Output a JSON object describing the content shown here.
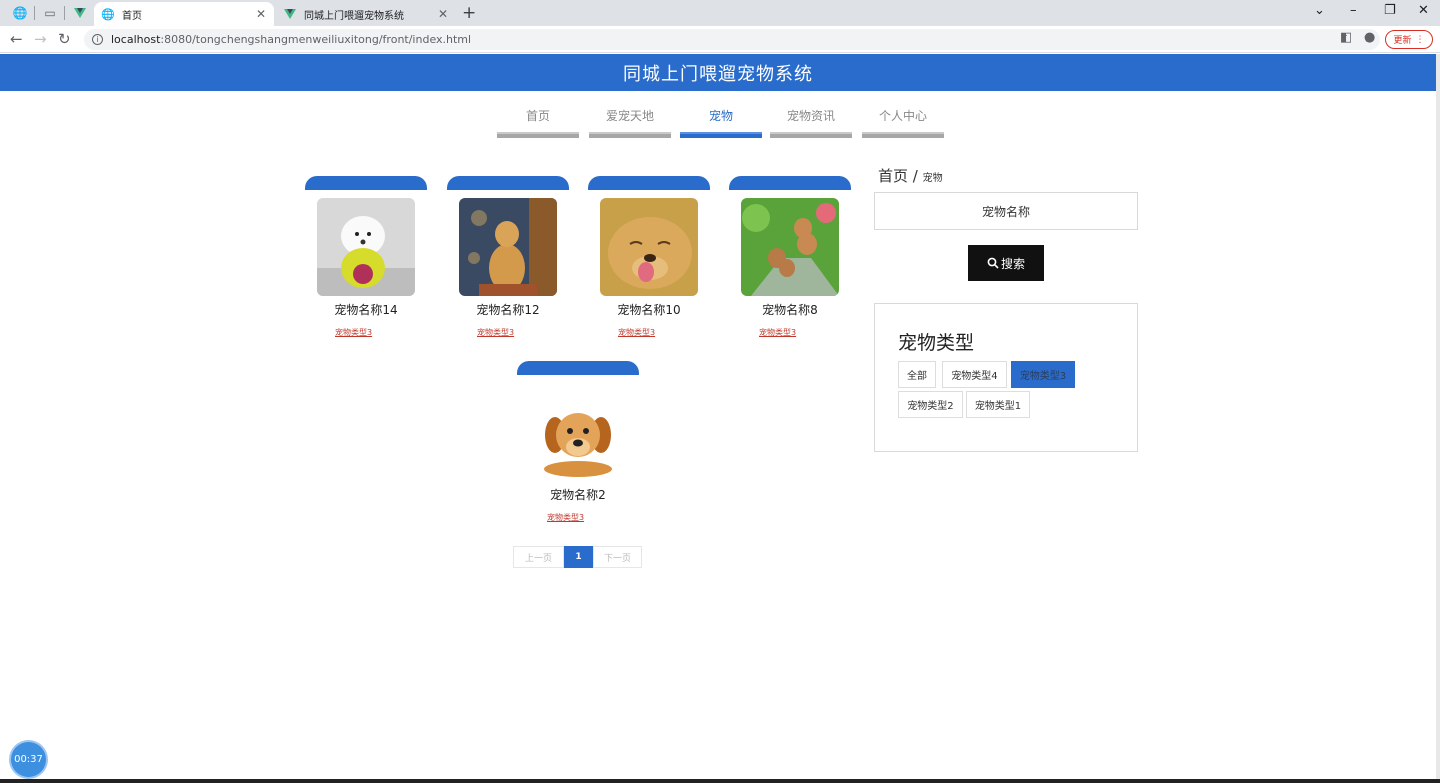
{
  "browser": {
    "tabs": [
      {
        "title": "首页",
        "active": true
      },
      {
        "title": "同城上门喂遛宠物系统",
        "active": false
      }
    ],
    "url_host": "localhost",
    "url_rest": ":8080/tongchengshangmenweiliuxitong/front/index.html",
    "update_label": "更新"
  },
  "site": {
    "title": "同城上门喂遛宠物系统",
    "menu": [
      {
        "label": "首页",
        "active": false
      },
      {
        "label": "爱宠天地",
        "active": false
      },
      {
        "label": "宠物",
        "active": true
      },
      {
        "label": "宠物资讯",
        "active": false
      },
      {
        "label": "个人中心",
        "active": false
      }
    ]
  },
  "pets": [
    {
      "name": "宠物名称14",
      "type": "宠物类型3",
      "image": "white-poodle"
    },
    {
      "name": "宠物名称12",
      "type": "宠物类型3",
      "image": "golden-retriever-sitting"
    },
    {
      "name": "宠物名称10",
      "type": "宠物类型3",
      "image": "golden-retriever-face"
    },
    {
      "name": "宠物名称8",
      "type": "宠物类型3",
      "image": "poodles-in-garden"
    },
    {
      "name": "宠物名称2",
      "type": "宠物类型3",
      "image": "golden-puppy"
    }
  ],
  "pagination": {
    "prev_label": "上一页",
    "current": "1",
    "next_label": "下一页"
  },
  "sidebar": {
    "breadcrumb_home": "首页",
    "breadcrumb_sep": "/",
    "breadcrumb_current": "宠物",
    "search_placeholder": "宠物名称",
    "search_button": "搜索",
    "type_title": "宠物类型",
    "type_tags": [
      {
        "label": "全部",
        "active": false
      },
      {
        "label": "宠物类型4",
        "active": false
      },
      {
        "label": "宠物类型3",
        "active": true
      },
      {
        "label": "宠物类型2",
        "active": false
      },
      {
        "label": "宠物类型1",
        "active": false
      }
    ]
  },
  "recorder": {
    "time": "00:37"
  },
  "colors": {
    "primary": "#2a6ccb",
    "link_red": "#c0392b",
    "search_button": "#111111"
  }
}
